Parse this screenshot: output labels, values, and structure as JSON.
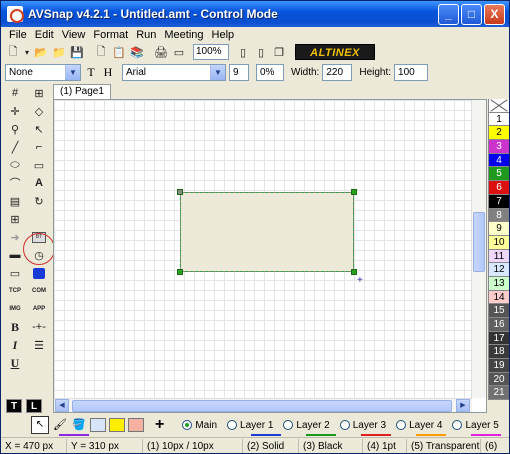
{
  "window": {
    "title": "AVSnap v4.2.1 - Untitled.amt - Control Mode",
    "controls": {
      "minimize": "_",
      "maximize": "□",
      "close": "X"
    }
  },
  "menu": [
    "File",
    "Edit",
    "View",
    "Format",
    "Run",
    "Meeting",
    "Help"
  ],
  "toolbar": {
    "zoom": "100%",
    "brand": "ALTINEX"
  },
  "format_bar": {
    "style": "None",
    "font": "Arial",
    "font_size": "9",
    "percent": "0%",
    "width_label": "Width:",
    "width_value": "220",
    "height_label": "Height:",
    "height_value": "100",
    "bold_t": "T",
    "bold_h": "H"
  },
  "toolbox": {
    "labels": {
      "bt": "BT",
      "tcp": "TCP",
      "com": "COM",
      "img": "IMG",
      "app": "APP",
      "ir": "IR",
      "b": "B",
      "i": "I",
      "u": "U",
      "t": "T",
      "l": "L"
    }
  },
  "tab": {
    "label": "(1) Page1"
  },
  "colors": {
    "items": [
      {
        "label": "1",
        "color": "#ffffff"
      },
      {
        "label": "2",
        "color": "#ffff00"
      },
      {
        "label": "3",
        "color": "#cc33cc"
      },
      {
        "label": "4",
        "color": "#0000ee"
      },
      {
        "label": "5",
        "color": "#1f9a1f"
      },
      {
        "label": "6",
        "color": "#dd1010"
      },
      {
        "label": "7",
        "color": "#000000"
      },
      {
        "label": "8",
        "color": "#808080"
      },
      {
        "label": "9",
        "color": "#ffffcc"
      },
      {
        "label": "10",
        "color": "#ffff99"
      },
      {
        "label": "11",
        "color": "#f0d8f8"
      },
      {
        "label": "12",
        "color": "#d8e8ff"
      },
      {
        "label": "13",
        "color": "#ccffcc"
      },
      {
        "label": "14",
        "color": "#ffcccc"
      },
      {
        "label": "15",
        "color": "#555555"
      },
      {
        "label": "16",
        "color": "#606060"
      },
      {
        "label": "17",
        "color": "#333333"
      },
      {
        "label": "18",
        "color": "#3a3a3a"
      },
      {
        "label": "19",
        "color": "#454545"
      },
      {
        "label": "20",
        "color": "#555555"
      },
      {
        "label": "21",
        "color": "#707070"
      }
    ]
  },
  "layers": {
    "main": "Main",
    "items": [
      "Layer 1",
      "Layer 2",
      "Layer 3",
      "Layer 4",
      "Layer 5"
    ],
    "selected": "Main"
  },
  "status": {
    "x": "X = 470 px",
    "y": "Y = 310 px",
    "grid": "(1) 10px / 10px",
    "line_style": "(2) Solid",
    "line_color": "(3) Black",
    "line_width": "(4) 1pt",
    "fill": "(5) Transparent",
    "extra": "(6)"
  }
}
